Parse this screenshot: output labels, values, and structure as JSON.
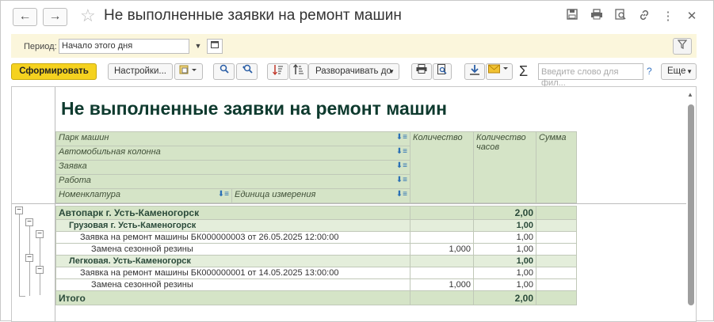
{
  "window": {
    "title": "Не выполненные заявки на ремонт машин",
    "back_icon": "←",
    "forward_icon": "→",
    "star_icon": "☆"
  },
  "params": {
    "period_label": "Период:",
    "period_value": "Начало этого дня"
  },
  "toolbar": {
    "generate_label": "Сформировать",
    "settings_label": "Настройки...",
    "expand_label": "Разворачивать до",
    "search_placeholder": "Введите слово для фил...",
    "help_label": "?",
    "more_label": "Еще"
  },
  "report": {
    "title": "Не выполненные заявки на ремонт машин",
    "headers": {
      "park": "Парк машин",
      "column": "Автомобильная колонна",
      "request": "Заявка",
      "work": "Работа",
      "nomenclature": "Номенклатура",
      "unit": "Единица измерения",
      "quantity": "Количество",
      "hours": "Количество часов",
      "sum": "Сумма"
    },
    "rows": [
      {
        "name": "Автопарк г. Усть-Каменогорск",
        "qty": "",
        "hours": "2,00",
        "sum": ""
      },
      {
        "name": "Грузовая г. Усть-Каменогорск",
        "qty": "",
        "hours": "1,00",
        "sum": ""
      },
      {
        "name": "Заявка на ремонт машины БК000000003 от 26.05.2025 12:00:00",
        "qty": "",
        "hours": "1,00",
        "sum": ""
      },
      {
        "name": "Замена сезонной резины",
        "qty": "1,000",
        "hours": "1,00",
        "sum": ""
      },
      {
        "name": "Легковая. Усть-Каменогорск",
        "qty": "",
        "hours": "1,00",
        "sum": ""
      },
      {
        "name": "Заявка на ремонт машины БК000000001 от 14.05.2025 13:00:00",
        "qty": "",
        "hours": "1,00",
        "sum": ""
      },
      {
        "name": "Замена сезонной резины",
        "qty": "1,000",
        "hours": "1,00",
        "sum": ""
      }
    ],
    "total": {
      "name": "Итого",
      "hours": "2,00"
    }
  }
}
